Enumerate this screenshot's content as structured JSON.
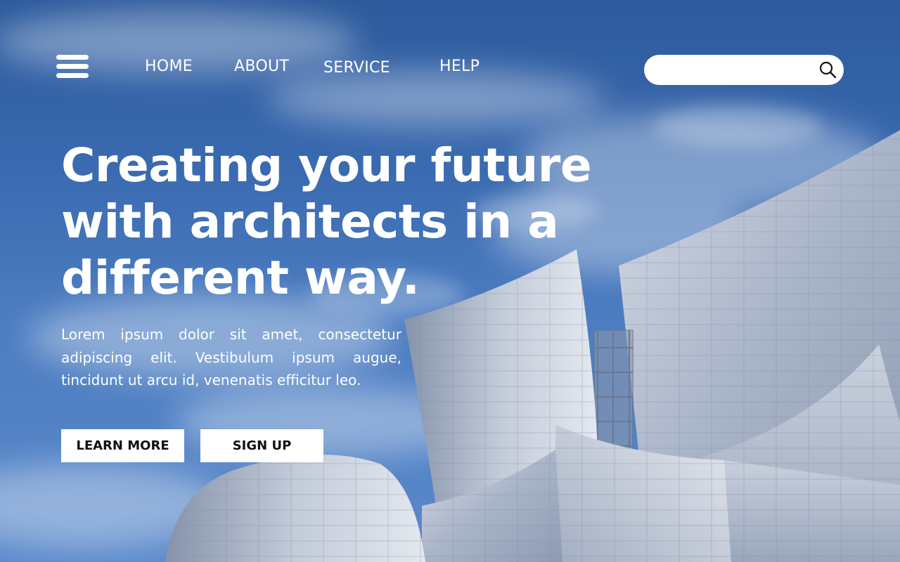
{
  "nav": {
    "menu_icon": "hamburger-menu-icon",
    "links": [
      "HOME",
      "ABOUT",
      "SERVICE",
      "HELP"
    ]
  },
  "search": {
    "placeholder": "",
    "value": "",
    "icon": "search-icon"
  },
  "hero": {
    "headline_lines": [
      "Creating your future",
      "with architects in a",
      "different way."
    ],
    "description": "Lorem ipsum dolor sit amet, consectetur adipiscing elit. Vestibulum ipsum augue, tincidunt ut arcu id, venenatis efficitur leo.",
    "buttons": {
      "learn_more": "LEARN MORE",
      "sign_up": "SIGN UP"
    }
  },
  "colors": {
    "sky": "#3a6ab0",
    "text": "#ffffff",
    "button_bg": "#ffffff",
    "button_text": "#111111",
    "metal": "#b9c3d6"
  }
}
